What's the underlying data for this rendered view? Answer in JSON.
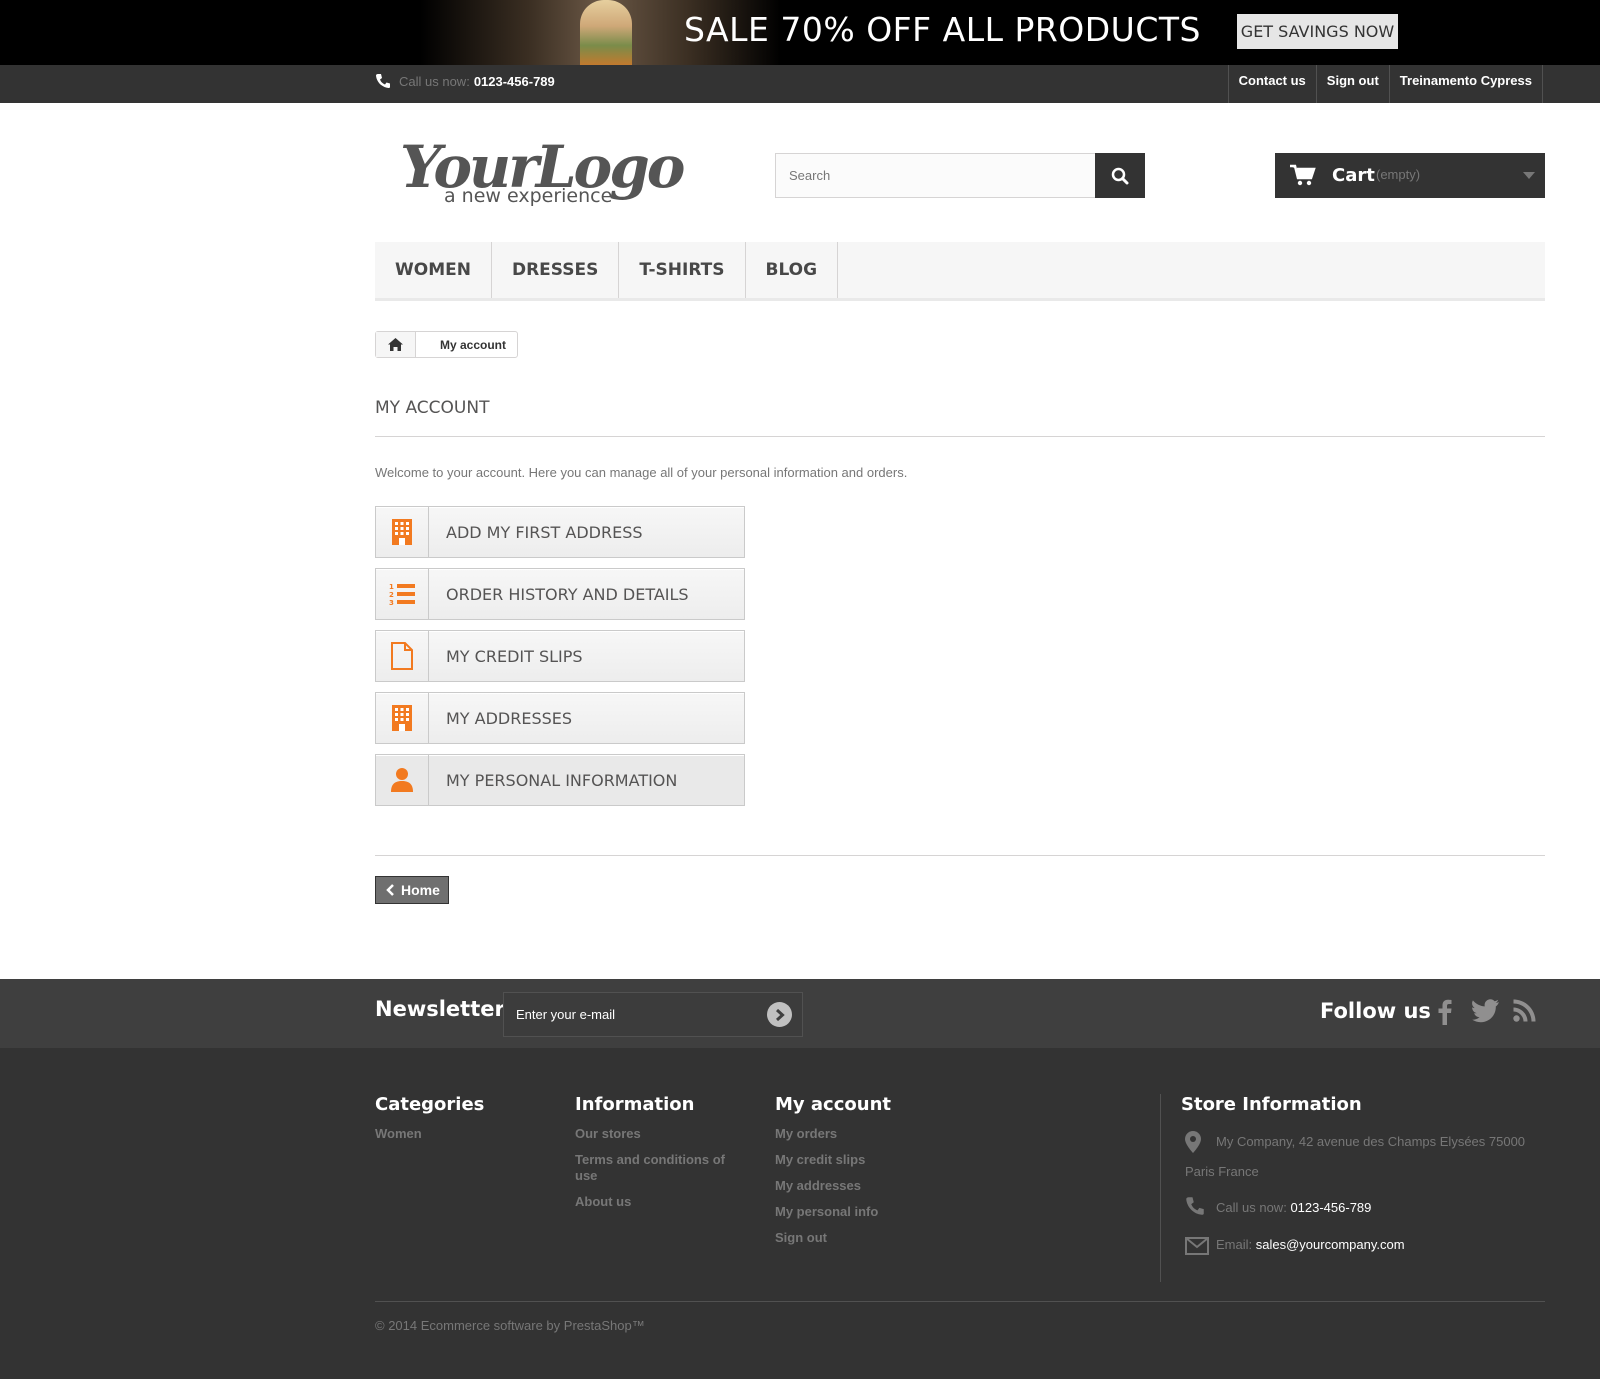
{
  "banner": {
    "headline": "SALE 70% OFF ALL PRODUCTS",
    "cta": "GET SAVINGS NOW"
  },
  "topnav": {
    "call_label": "Call us now:",
    "phone": "0123-456-789",
    "links": [
      "Contact us",
      "Sign out",
      "Treinamento Cypress"
    ]
  },
  "header": {
    "logo_text": "YourLogo",
    "logo_tagline": "a new experience",
    "search_placeholder": "Search",
    "cart_label": "Cart",
    "cart_status": "(empty)"
  },
  "menu": {
    "items": [
      "WOMEN",
      "DRESSES",
      "T-SHIRTS",
      "BLOG"
    ]
  },
  "breadcrumb": {
    "current": "My account"
  },
  "main": {
    "heading": "MY ACCOUNT",
    "welcome": "Welcome to your account. Here you can manage all of your personal information and orders.",
    "account_links": [
      {
        "label": "ADD MY FIRST ADDRESS",
        "icon": "building-icon"
      },
      {
        "label": "ORDER HISTORY AND DETAILS",
        "icon": "numbered-list-icon"
      },
      {
        "label": "MY CREDIT SLIPS",
        "icon": "document-icon"
      },
      {
        "label": "MY ADDRESSES",
        "icon": "building-icon"
      },
      {
        "label": "MY PERSONAL INFORMATION",
        "icon": "user-icon"
      }
    ],
    "home_button": "Home"
  },
  "newsletter": {
    "title": "Newsletter",
    "placeholder": "Enter your e-mail",
    "follow_title": "Follow us",
    "social": [
      "facebook-icon",
      "twitter-icon",
      "rss-icon"
    ]
  },
  "footer": {
    "categories": {
      "title": "Categories",
      "links": [
        "Women"
      ]
    },
    "information": {
      "title": "Information",
      "links": [
        "Our stores",
        "Terms and conditions of use",
        "About us"
      ]
    },
    "my_account": {
      "title": "My account",
      "links": [
        "My orders",
        "My credit slips",
        "My addresses",
        "My personal info",
        "Sign out"
      ]
    },
    "store": {
      "title": "Store Information",
      "address_line1": "My Company, 42 avenue des Champs Elysées 75000",
      "address_line2": "Paris France",
      "call_label": "Call us now:",
      "phone": "0123-456-789",
      "email_label": "Email:",
      "email": "sales@yourcompany.com"
    },
    "copyright": "© 2014 Ecommerce software by PrestaShop™"
  },
  "colors": {
    "accent": "#f27a20",
    "dark": "#333333",
    "band": "#3f3f3f"
  }
}
